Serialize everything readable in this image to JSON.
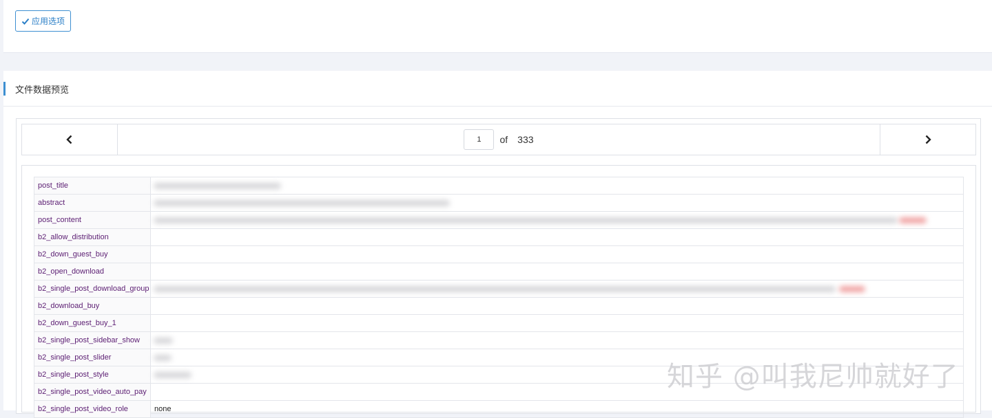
{
  "toolbar": {
    "apply_label": "应用选项"
  },
  "section": {
    "title": "文件数据预览"
  },
  "pager": {
    "current_page": "1",
    "of_label": "of",
    "total_pages": "333"
  },
  "fields": [
    {
      "key": "post_title",
      "value": ""
    },
    {
      "key": "abstract",
      "value": ""
    },
    {
      "key": "post_content",
      "value": ""
    },
    {
      "key": "b2_allow_distribution",
      "value": ""
    },
    {
      "key": "b2_down_guest_buy",
      "value": ""
    },
    {
      "key": "b2_open_download",
      "value": ""
    },
    {
      "key": "b2_single_post_download_group",
      "value": ""
    },
    {
      "key": "b2_download_buy",
      "value": ""
    },
    {
      "key": "b2_down_guest_buy_1",
      "value": ""
    },
    {
      "key": "b2_single_post_sidebar_show",
      "value": ""
    },
    {
      "key": "b2_single_post_slider",
      "value": ""
    },
    {
      "key": "b2_single_post_style",
      "value": ""
    },
    {
      "key": "b2_single_post_video_auto_pay",
      "value": ""
    },
    {
      "key": "b2_single_post_video_role",
      "value": "none"
    }
  ],
  "watermark": "知乎 @叫我尼帅就好了",
  "colors": {
    "accent": "#3d8fd1",
    "field_key": "#5b1d72"
  }
}
